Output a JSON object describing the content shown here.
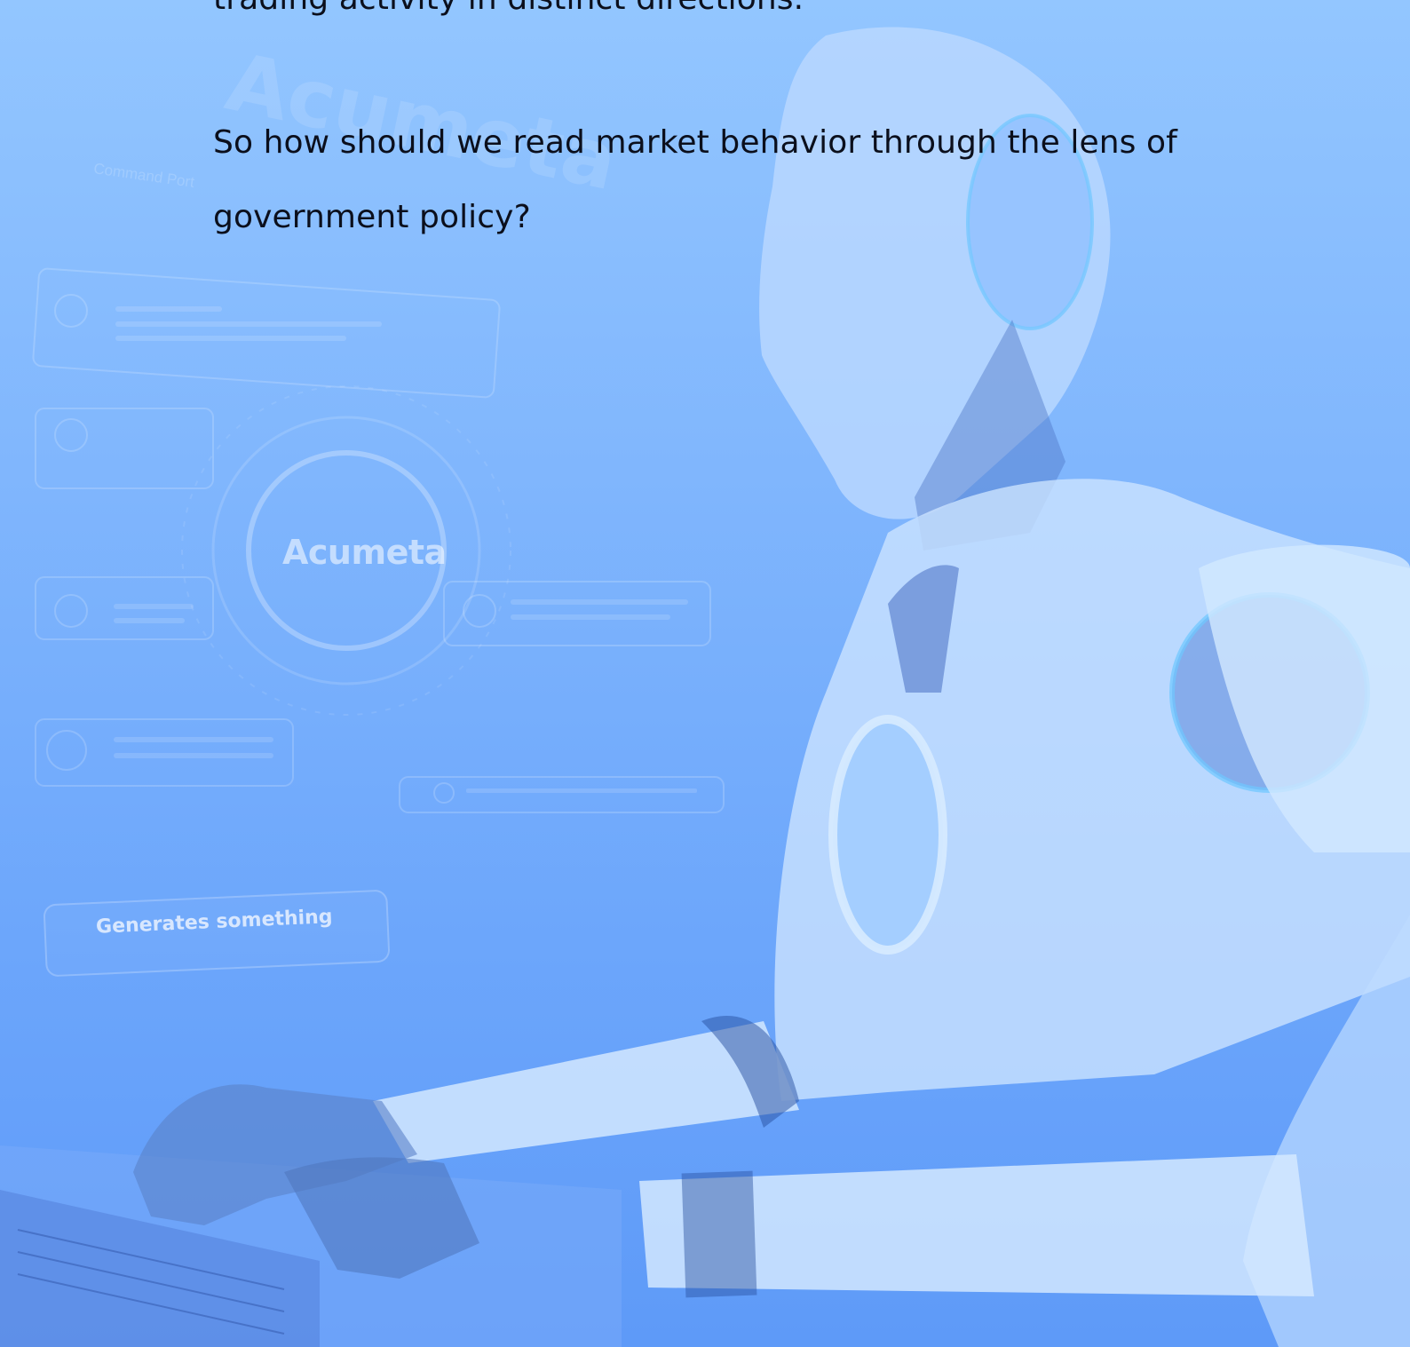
{
  "article": {
    "partial_line": "trading activity in distinct directions.",
    "line_1": "So how should we read market behavior through the lens of",
    "line_2": "government policy?"
  },
  "background": {
    "watermark_text": "Acumeta",
    "logo_text": "Acumeta",
    "small_label": "Command Port",
    "panel_label": "Generates something",
    "tint_color": "#7db3fd"
  }
}
